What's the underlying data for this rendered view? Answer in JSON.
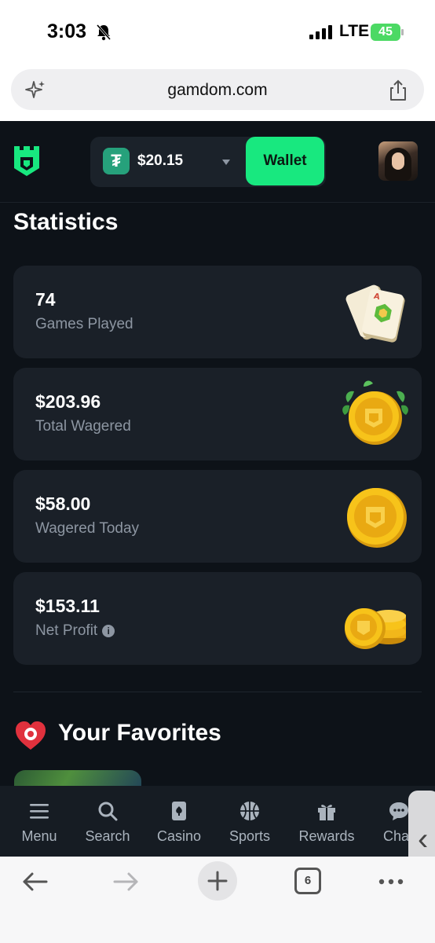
{
  "status_bar": {
    "time": "3:03",
    "network": "LTE",
    "battery": "45"
  },
  "browser": {
    "url": "gamdom.com",
    "tabs_count": "6"
  },
  "header": {
    "balance": "$20.15",
    "wallet_label": "Wallet",
    "currency_icon": "tether-icon"
  },
  "statistics": {
    "title": "Statistics",
    "cards": [
      {
        "value": "74",
        "label": "Games Played",
        "icon": "mahjong-tiles-icon"
      },
      {
        "value": "$203.96",
        "label": "Total Wagered",
        "icon": "coin-leaves-icon"
      },
      {
        "value": "$58.00",
        "label": "Wagered Today",
        "icon": "coin-icon"
      },
      {
        "value": "$153.11",
        "label": "Net Profit",
        "icon": "coin-stack-icon"
      }
    ]
  },
  "favorites": {
    "title": "Your Favorites"
  },
  "bottom_nav": [
    {
      "label": "Menu",
      "icon": "menu-icon"
    },
    {
      "label": "Search",
      "icon": "search-icon"
    },
    {
      "label": "Casino",
      "icon": "casino-icon"
    },
    {
      "label": "Sports",
      "icon": "sports-icon"
    },
    {
      "label": "Rewards",
      "icon": "gift-icon"
    },
    {
      "label": "Cha",
      "icon": "chat-icon"
    }
  ],
  "colors": {
    "accent": "#18e87f",
    "background": "#0d1218",
    "card": "#1a2028",
    "muted_text": "#8d96a2"
  }
}
